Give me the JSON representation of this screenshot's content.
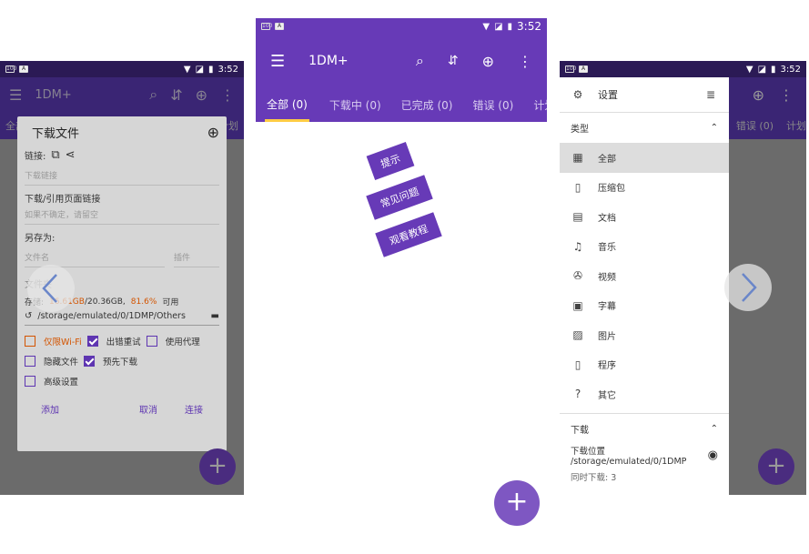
{
  "status": {
    "time": "3:52",
    "battery_icon": "battery-icon",
    "a_icon": "A"
  },
  "app": {
    "title": "1DM+"
  },
  "tabs": [
    "全部 (0)",
    "下载中 (0)",
    "已完成 (0)",
    "错误 (0)",
    "计划"
  ],
  "tabs_dim": [
    "全部",
    "下载中",
    "已完成",
    "错误 (0)",
    "计划"
  ],
  "dialog": {
    "title": "下载文件",
    "link_label": "链接:",
    "link_placeholder": "下载链接",
    "ref_label": "下载/引用页面链接",
    "ref_placeholder": "如果不确定，请留空",
    "saveas_label": "另存为:",
    "filename_placeholder": "文件名",
    "plugin_placeholder": "插件",
    "folder_label": "文件夹",
    "storage_prefix": "存储:",
    "storage_used": "16.61GB",
    "storage_total": "/20.36GB,",
    "storage_pct": "81.6%",
    "storage_suffix": "可用",
    "path": "/storage/emulated/0/1DMP/Others",
    "opts": {
      "wifi": "仅限Wi-Fi",
      "retry": "出错重试",
      "proxy": "使用代理",
      "hidden": "隐藏文件",
      "preload": "预先下载",
      "advanced": "高级设置"
    },
    "add": "添加",
    "cancel": "取消",
    "connect": "连接"
  },
  "hints": [
    "提示",
    "常见问题",
    "观看教程"
  ],
  "drawer": {
    "settings": "设置",
    "type_section": "类型",
    "items": [
      "全部",
      "压缩包",
      "文档",
      "音乐",
      "视频",
      "字幕",
      "图片",
      "程序",
      "其它"
    ],
    "download_section": "下载",
    "location_label": "下载位置",
    "location_path": "/storage/emulated/0/1DMP",
    "concurrent": "同时下载:  3"
  },
  "colors": {
    "primary": "#673ab7",
    "accent": "#ffcc44",
    "red": "#d35400"
  }
}
